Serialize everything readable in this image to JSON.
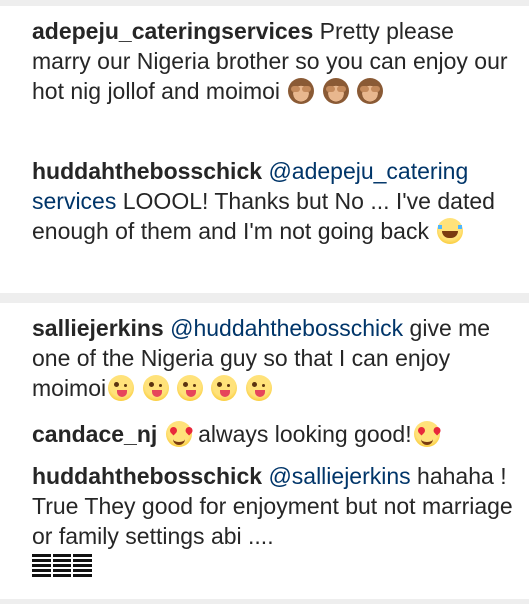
{
  "comments": [
    {
      "username": "adepeju_cateringservices",
      "text": " Pretty please marry our Nigeria brother so you can enjoy our hot nig jollof and moimoi",
      "emojis": [
        "see-no-evil-monkey",
        "see-no-evil-monkey",
        "see-no-evil-monkey"
      ]
    },
    {
      "username": "huddahthebosschick",
      "mention": "@adepeju_catering services",
      "text": " LOOOL! Thanks but No ... I've dated enough of them and I'm not going back",
      "emojis": [
        "tears-of-joy"
      ]
    },
    {
      "username": "salliejerkins",
      "mention": "@huddahthebosschick",
      "text": " give me one of the Nigeria guy so that I can enjoy moimoi",
      "emojis": [
        "winking-tongue",
        "winking-tongue",
        "winking-tongue",
        "winking-tongue",
        "winking-tongue"
      ]
    },
    {
      "username": "candace_nj",
      "text": " always looking good!",
      "emojis_before": [
        "heart-eyes"
      ],
      "emojis": [
        "heart-eyes"
      ]
    },
    {
      "username": "huddahthebosschick",
      "mention": "@salliejerkins",
      "text": " hahaha ! True They good for enjoyment but not marriage or family settings abi ....",
      "emojis": [
        "flag"
      ]
    }
  ],
  "colors": {
    "background": "#eeeeee",
    "card": "#ffffff",
    "text": "#262626",
    "mention": "#003569"
  }
}
